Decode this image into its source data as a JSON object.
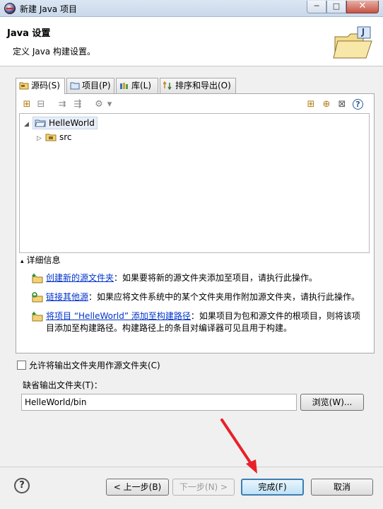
{
  "window": {
    "title": "新建 Java 项目",
    "min": "─",
    "max": "□",
    "close": "✕"
  },
  "header": {
    "heading": "Java 设置",
    "description": "定义 Java 构建设置。"
  },
  "tabs": [
    {
      "label": "源码(S)",
      "icon": "source-folder-icon",
      "active": true
    },
    {
      "label": "项目(P)",
      "icon": "project-icon",
      "active": false
    },
    {
      "label": "库(L)",
      "icon": "library-icon",
      "active": false
    },
    {
      "label": "排序和导出(O)",
      "icon": "order-export-icon",
      "active": false
    }
  ],
  "toolbar": {
    "help": "?",
    "dropdown": "▾"
  },
  "tree": {
    "items": [
      {
        "label": "HelleWorld",
        "expanded": true,
        "selected": true,
        "icon": "project-folder-icon"
      },
      {
        "label": "src",
        "expanded": false,
        "icon": "source-package-icon"
      }
    ],
    "expanded_glyph": "◢",
    "collapsed_glyph": "▷"
  },
  "details": {
    "title": "详细信息",
    "toggle": "▴",
    "lines": [
      {
        "link": "创建新的源文件夹",
        "text": "：如果要将新的源文件夹添加至项目，请执行此操作。"
      },
      {
        "link": "链接其他源",
        "text": "：如果应将文件系统中的某个文件夹用作附加源文件夹，请执行此操作。"
      },
      {
        "link": "将项目 “HelleWorld” 添加至构建路径",
        "text": "：如果项目为包和源文件的根项目，则将该项",
        "text2": "目添加至构建路径。构建路径上的条目对编译器可见且用于构建。"
      }
    ]
  },
  "allow_output_folders": {
    "label": "允许将输出文件夹用作源文件夹(C)",
    "checked": false
  },
  "default_output": {
    "label": "缺省输出文件夹(T)：",
    "value": "HelleWorld/bin",
    "browse": "浏览(W)..."
  },
  "footer": {
    "help": "?",
    "back": "< 上一步(B)",
    "next": "下一步(N) >",
    "finish": "完成(F)",
    "cancel": "取消"
  },
  "colors": {
    "link": "#0033cc",
    "annotation_arrow": "#e8202a"
  }
}
